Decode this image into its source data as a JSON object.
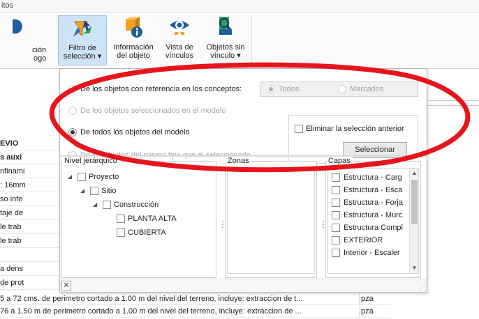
{
  "window": {
    "title_fragment": "itos"
  },
  "ribbon": {
    "left_button": {
      "line1": "ción",
      "line2": "ogo"
    },
    "filtro": {
      "line1": "Filtro de",
      "line2": "selección ▾"
    },
    "informacion": {
      "line1": "Información",
      "line2": "del objeto"
    },
    "vista": {
      "line1": "Vista de",
      "line2": "vínculos"
    },
    "objetos": {
      "line1": "Objetos sin",
      "line2": "vínculo ▾"
    }
  },
  "background_rows": [
    {
      "text": "EVIO",
      "bold": true
    },
    {
      "text": "s auxi",
      "bold": true
    },
    {
      "text": "nfinami",
      "bold": false
    },
    {
      "text": ": 16mm",
      "bold": false
    },
    {
      "text": "so infe",
      "bold": false
    },
    {
      "text": "taje de",
      "bold": false
    },
    {
      "text": "le trab",
      "bold": false
    },
    {
      "text": "le trab",
      "bold": false
    },
    {
      "text": "",
      "bold": false
    },
    {
      "text": "a dens",
      "bold": false
    },
    {
      "text": "de prot",
      "bold": false
    }
  ],
  "bottom_rows": [
    {
      "text": "5 a 72 cms. de perimetro cortado a 1.00 m del nivel del terreno, incluye: extraccion de t...",
      "unit": "pza"
    },
    {
      "text": "76 a 1.50 m de perimetro cortado a 1.00 m del nivel del terreno, incluye: extraccion de ...",
      "unit": "pza"
    }
  ],
  "popup": {
    "option_referencia": "De los objetos con referencia en los conceptos:",
    "option_seleccionados": "De los objetos seleccionados en el modelo",
    "option_todos": "De todos los objetos del modelo",
    "option_mismo_tipo": "De los objetos del mismo tipo que el seleccionado",
    "segment_todos": "Todos",
    "segment_marcados": "Marcados",
    "eliminar_label": "Eliminar la selección anterior",
    "seleccionar_button": "Seleccionar",
    "nivel_title": "Nivel jerárquico",
    "zonas_title": "Zonas",
    "capas_title": "Capas",
    "tree": [
      {
        "label": "Proyecto"
      },
      {
        "label": "Sitio"
      },
      {
        "label": "Construcción"
      },
      {
        "label": "PLANTA ALTA"
      },
      {
        "label": "CUBIERTA"
      }
    ],
    "capas": [
      "Estructura - Carg",
      "Estructura - Esca",
      "Estructura - Forja",
      "Estructura - Murc",
      "Estructura Compl",
      "EXTERIOR",
      "Interior - Escaler"
    ],
    "close_glyph": "✕"
  },
  "annotation_color": "#e8141b"
}
